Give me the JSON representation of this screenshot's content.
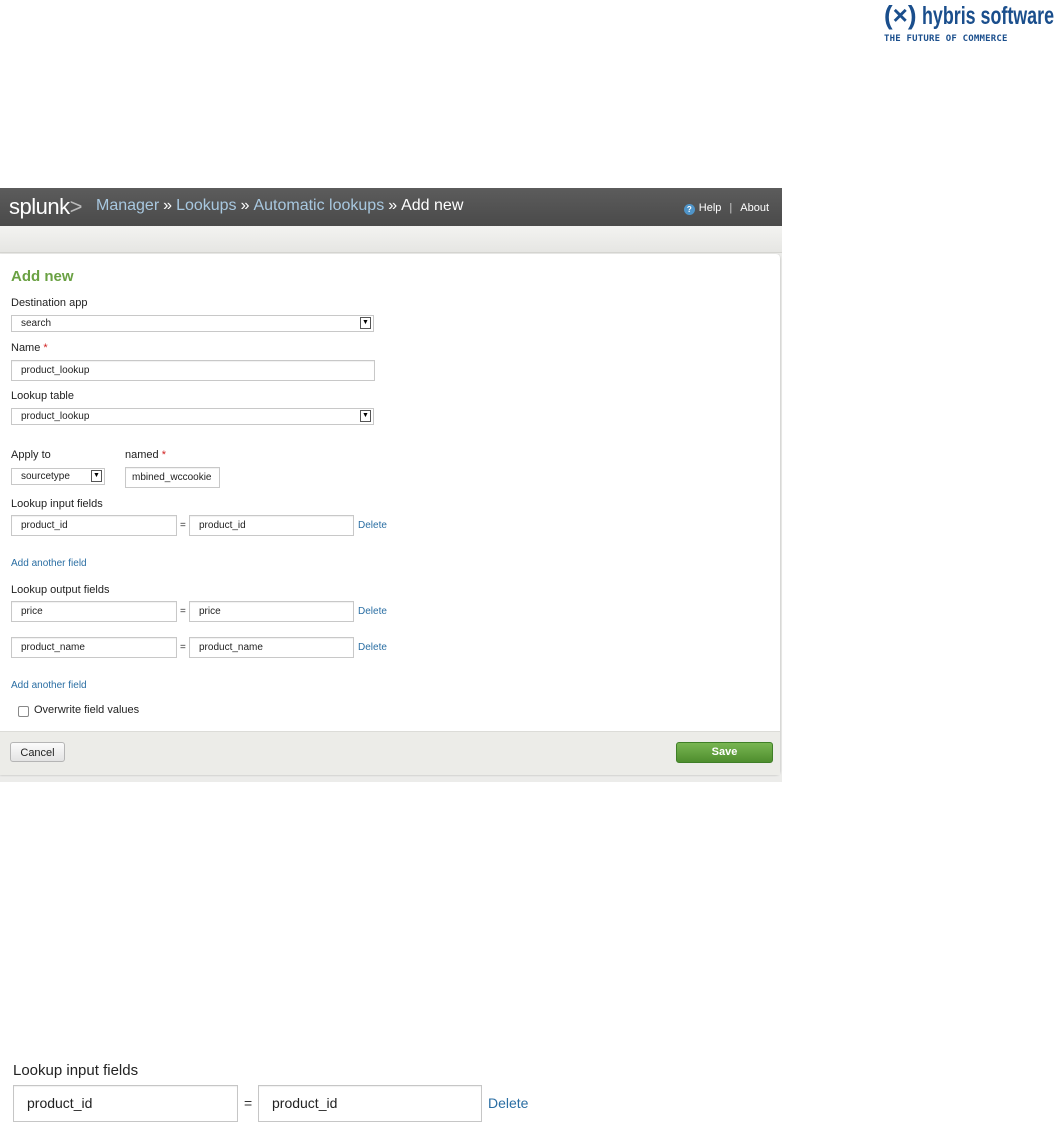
{
  "brand": {
    "name": "hybris software",
    "tagline": "THE FUTURE OF COMMERCE",
    "color": "#1a4e8c"
  },
  "topbar": {
    "logo_text": "splunk",
    "logo_mark": ">",
    "breadcrumbs": [
      "Manager",
      "Lookups",
      "Automatic lookups"
    ],
    "current": "Add new",
    "separator": "»",
    "help_label": "Help",
    "about_label": "About",
    "divider": "|",
    "help_icon": "question-circle-icon"
  },
  "form": {
    "title": "Add new",
    "destination_app": {
      "label": "Destination app",
      "value": "search"
    },
    "name": {
      "label": "Name",
      "required_mark": "*",
      "value": "product_lookup"
    },
    "lookup_table": {
      "label": "Lookup table",
      "value": "product_lookup"
    },
    "apply_to": {
      "label": "Apply to",
      "value": "sourcetype"
    },
    "named": {
      "label": "named",
      "required_mark": "*",
      "value": "mbined_wccookie"
    },
    "input_fields": {
      "label": "Lookup input fields",
      "rows": [
        {
          "left": "product_id",
          "eq": "=",
          "right": "product_id",
          "delete": "Delete"
        }
      ],
      "add_label": "Add another field"
    },
    "output_fields": {
      "label": "Lookup output fields",
      "rows": [
        {
          "left": "price",
          "eq": "=",
          "right": "price",
          "delete": "Delete"
        },
        {
          "left": "product_name",
          "eq": "=",
          "right": "product_name",
          "delete": "Delete"
        }
      ],
      "add_label": "Add another field"
    },
    "overwrite": {
      "label": "Overwrite field values",
      "checked": false
    },
    "cancel_label": "Cancel",
    "save_label": "Save",
    "accent_color": "#6aa143"
  },
  "zoom": {
    "label": "Lookup input fields",
    "left": "product_id",
    "eq": "=",
    "right": "product_id",
    "delete": "Delete"
  }
}
